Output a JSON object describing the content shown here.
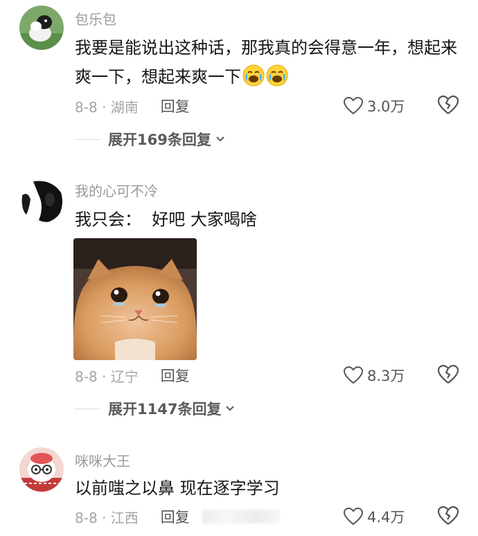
{
  "comments": [
    {
      "username": "包乐包",
      "text": "我要是能说出这种话，那我真的会得意一年，想起来爽一下，想起来爽一下",
      "emojis": [
        "crying-laughing-emoji",
        "crying-laughing-emoji"
      ],
      "date_location": "8-8 · 湖南",
      "reply_label": "回复",
      "likes": "3.0万",
      "expand_label": "展开169条回复"
    },
    {
      "username": "我的心可不冷",
      "text": "我只会：  好吧 大家喝啥",
      "image": "crying-cat-meme",
      "date_location": "8-8 · 辽宁",
      "reply_label": "回复",
      "likes": "8.3万",
      "expand_label": "展开1147条回复"
    },
    {
      "username": "咪咪大王",
      "text": "以前嗤之以鼻 现在逐字学习",
      "date_location": "8-8 · 江西",
      "reply_label": "回复",
      "likes": "4.4万"
    }
  ],
  "colors": {
    "username": "#9a9a9a",
    "text": "#161616",
    "meta": "#a4a4a4",
    "action": "#555555"
  }
}
